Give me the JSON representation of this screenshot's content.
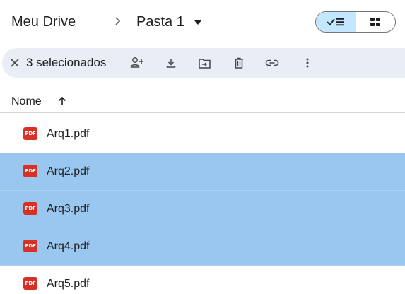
{
  "breadcrumb": {
    "root_label": "Meu Drive",
    "current_folder": "Pasta 1"
  },
  "view_toggle": {
    "list_icon": "check-list-icon",
    "grid_icon": "grid-icon",
    "active": "list"
  },
  "selection_toolbar": {
    "count_label": "3 selecionados",
    "actions": [
      "share-icon",
      "download-icon",
      "move-icon",
      "trash-icon",
      "link-icon",
      "more-vert-icon"
    ]
  },
  "list": {
    "column_name": "Nome",
    "sort": "ascending",
    "files": [
      {
        "name": "Arq1.pdf",
        "type": "PDF",
        "selected": false
      },
      {
        "name": "Arq2.pdf",
        "type": "PDF",
        "selected": true
      },
      {
        "name": "Arq3.pdf",
        "type": "PDF",
        "selected": true
      },
      {
        "name": "Arq4.pdf",
        "type": "PDF",
        "selected": true
      },
      {
        "name": "Arq5.pdf",
        "type": "PDF",
        "selected": false
      }
    ]
  },
  "colors": {
    "selected_row": "#99c7ef",
    "toolbar_bg": "#e9eef6",
    "toggle_active": "#c2e7ff",
    "pdf_red": "#d93025"
  }
}
